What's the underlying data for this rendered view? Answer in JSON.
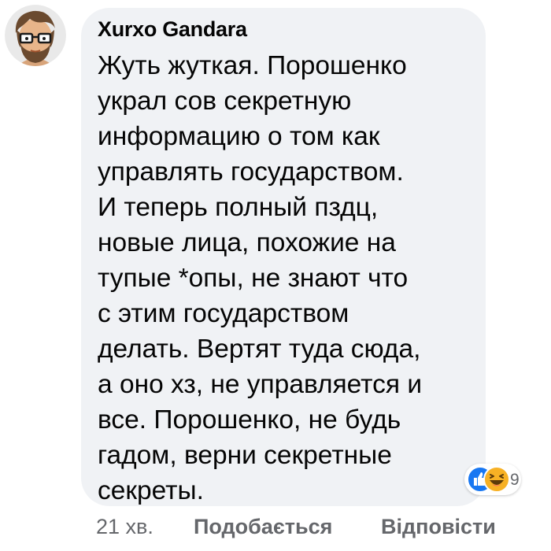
{
  "comment": {
    "author": "Xurxo Gandara",
    "lines": [
      "Жуть жуткая. Порошенко",
      "украл сов секретную",
      "информацию о том как",
      "управлять государством.",
      "И теперь полный пздц,",
      "новые лица, похожие на",
      "тупые *опы, не знают что",
      "с этим государством",
      "делать. Вертят туда сюда,",
      "а оно хз, не управляется и",
      "все. Порошенко, не будь",
      "гадом, верни секретные",
      "секреты."
    ],
    "reactions": {
      "icons": [
        "like-icon",
        "haha-icon"
      ],
      "count": "9"
    },
    "time": "21 хв.",
    "like_label": "Подобається",
    "reply_label": "Відповісти"
  },
  "colors": {
    "bubble_bg": "#f0f2f5",
    "text": "#050505",
    "meta_text": "#65676b",
    "like_blue": "#1877f2",
    "haha_yellow": "#f7b125"
  }
}
